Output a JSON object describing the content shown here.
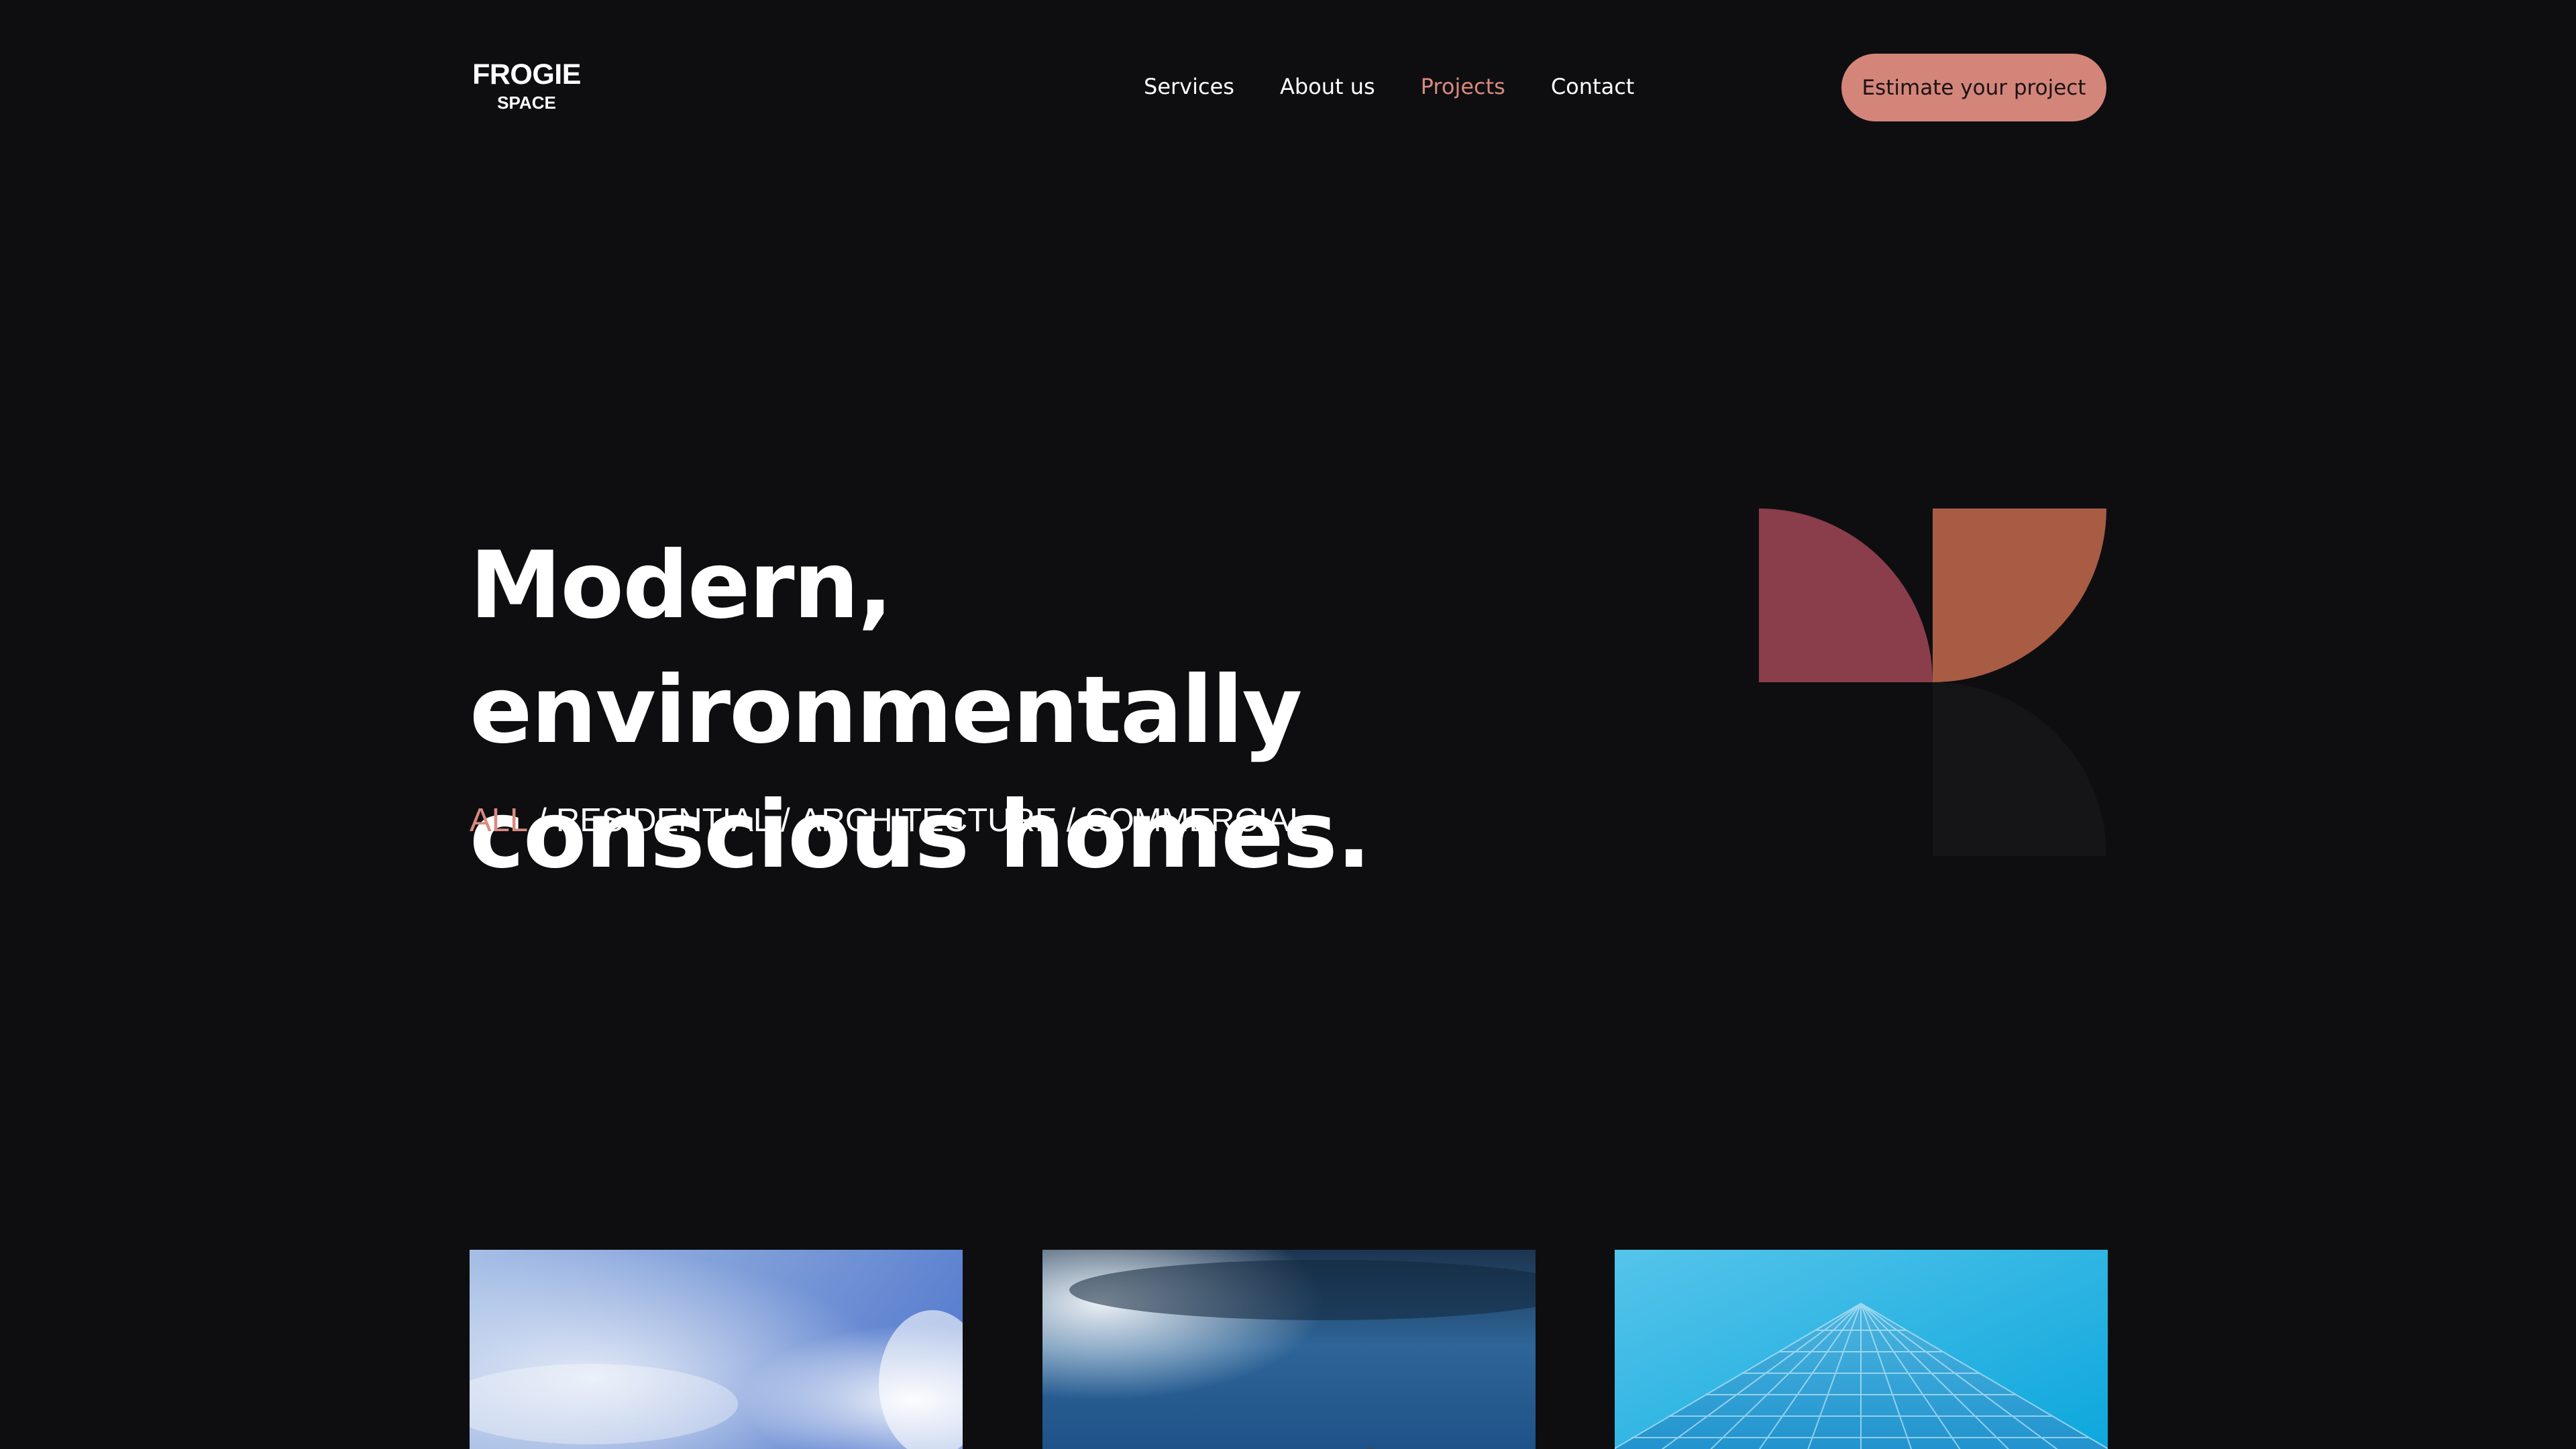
{
  "header": {
    "logo": {
      "line1": "FROGIE",
      "line2": "SPACE"
    },
    "nav": [
      {
        "label": "Services",
        "active": false
      },
      {
        "label": "About us",
        "active": false
      },
      {
        "label": "Projects",
        "active": true
      },
      {
        "label": "Contact",
        "active": false
      }
    ],
    "cta_label": "Estimate your project"
  },
  "hero": {
    "title_line1": "Modern, environmentally",
    "title_line2": "conscious homes.",
    "filters": [
      {
        "label": "ALL",
        "active": true
      },
      {
        "label": "RESIDENTIAL",
        "active": false
      },
      {
        "label": "ARCHITECTURE",
        "active": false
      },
      {
        "label": "COMMERCIAL",
        "active": false
      }
    ],
    "filter_separator": "/"
  },
  "colors": {
    "background": "#0e0e11",
    "accent": "#d4857a",
    "accent_text": "#d98a7e",
    "shape_crimson": "#8a3d4a",
    "shape_rust": "#a85c44",
    "shape_dark": "#151517"
  },
  "projects": [
    {
      "image": "sky-with-clouds-photo"
    },
    {
      "image": "blue-sky-storm-photo"
    },
    {
      "image": "glass-skyscraper-photo"
    }
  ]
}
